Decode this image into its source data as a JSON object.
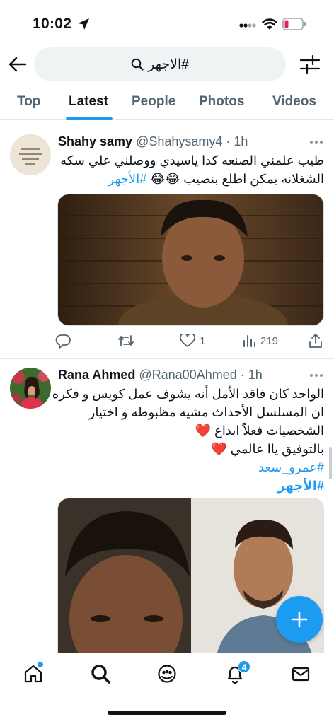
{
  "status_bar": {
    "time": "10:02"
  },
  "search": {
    "query": "#الاجهر"
  },
  "tabs": [
    {
      "label": "Top"
    },
    {
      "label": "Latest"
    },
    {
      "label": "People"
    },
    {
      "label": "Photos"
    },
    {
      "label": "Videos"
    }
  ],
  "active_tab": "Latest",
  "tweets": [
    {
      "name": "Shahy samy",
      "handle": "@Shahysamy4",
      "time": "· 1h",
      "lines": [
        "طيب علمني الصنعه كدا  ياسيدي ووصلني علي سكه",
        "الشغلانه يمكن اطلع بنصيب 😂😂 "
      ],
      "hashtags": [
        "#الأجهر"
      ],
      "replies": "",
      "retweets": "",
      "likes": "1",
      "views": "219"
    },
    {
      "name": "Rana Ahmed",
      "handle": "@Rana00Ahmed",
      "time": "· 1h",
      "lines": [
        "الواحد كان فاقد الأمل أنه يشوف عمل كويس و فكره",
        "ان المسلسل الأحداث مشيه مظبوطه و اختيار",
        "الشخصيات فعلاً ابداع ❤️",
        "بالتوفيق ياا عالمي ❤️"
      ],
      "hashtags": [
        "#عمرو_سعد",
        "#الأجهر"
      ]
    }
  ],
  "notifications_badge": "4",
  "icons": {
    "back": "arrow-left-icon",
    "search": "search-icon",
    "filter": "sliders-icon",
    "reply": "reply-icon",
    "retweet": "retweet-icon",
    "like": "heart-icon",
    "views": "views-icon",
    "share": "share-icon",
    "compose": "plus-icon",
    "home": "home-icon",
    "explore": "search-icon",
    "communities": "communities-icon",
    "notifications": "bell-icon",
    "messages": "mail-icon"
  },
  "colors": {
    "accent": "#1d9bf0",
    "text": "#0f1419",
    "muted": "#536471",
    "search_bg": "#eff3f4",
    "battery_low": "#e0245e"
  }
}
